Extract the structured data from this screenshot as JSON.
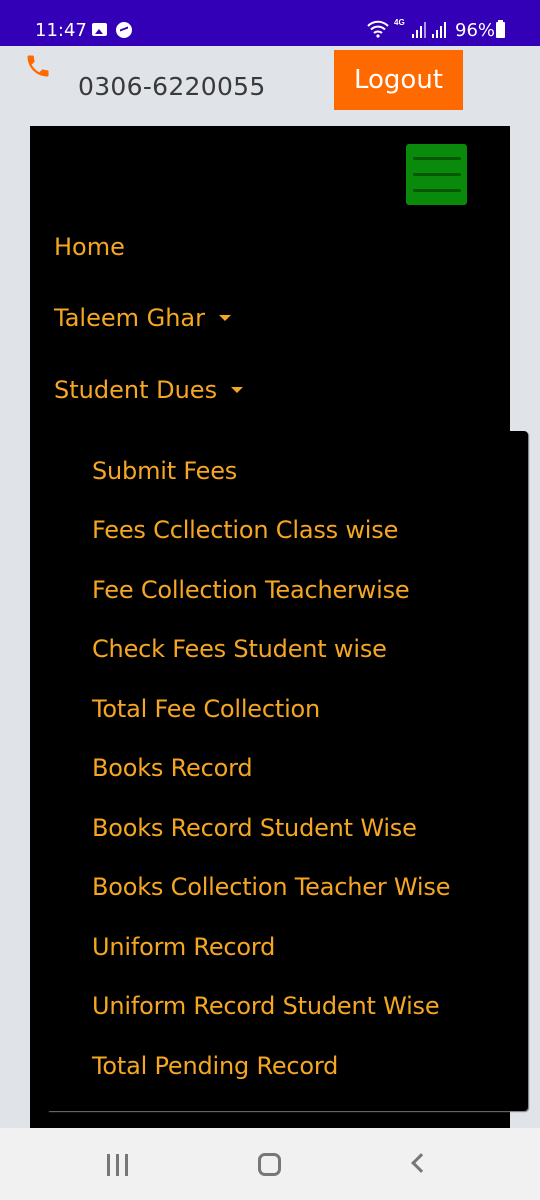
{
  "status_bar": {
    "time": "11:47",
    "network": "4G",
    "battery": "96%",
    "icons": [
      "gallery-icon",
      "messenger-icon",
      "wifi-icon",
      "signal-icon",
      "signal-icon",
      "battery-icon"
    ]
  },
  "header": {
    "phone_icon": "phone-icon",
    "phone_number": "0306-6220055",
    "logout_label": "Logout"
  },
  "navbar": {
    "menu_icon": "hamburger-menu-icon",
    "items": [
      {
        "label": "Home",
        "has_dropdown": false
      },
      {
        "label": "Taleem Ghar",
        "has_dropdown": true
      },
      {
        "label": "Student Dues",
        "has_dropdown": true,
        "expanded": true
      }
    ],
    "dropdown_items": [
      "Submit Fees",
      "Fees Ccllection Class wise",
      "Fee Collection Teacherwise",
      "Check Fees Student wise",
      "Total Fee Collection",
      "Books Record",
      "Books Record Student Wise",
      "Books Collection Teacher Wise",
      "Uniform Record",
      "Uniform Record Student Wise",
      "Total Pending Record"
    ]
  },
  "colors": {
    "status_bar": "#3300b8",
    "accent_orange": "#ff6a00",
    "menu_text": "#f5a623",
    "hamburger_green": "#0a8a0a",
    "navbar_bg": "#000000",
    "page_bg": "#e0e3e8"
  },
  "system_nav": {
    "buttons": [
      "recents-icon",
      "home-icon",
      "back-icon"
    ]
  }
}
